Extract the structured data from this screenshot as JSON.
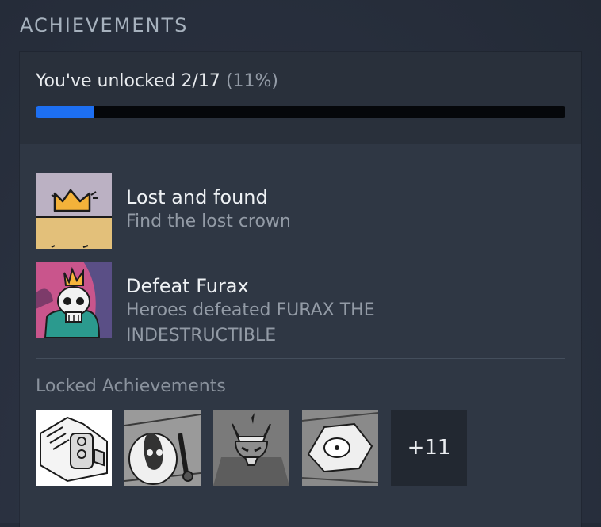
{
  "section": {
    "title": "ACHIEVEMENTS"
  },
  "progress": {
    "text": "You've unlocked 2/17",
    "percent_text": "(11%)",
    "fraction": 0.11
  },
  "unlocked": [
    {
      "title": "Lost and found",
      "description": "Find the lost crown",
      "icon": "crown-achievement-icon"
    },
    {
      "title": "Defeat Furax",
      "description": "Heroes defeated FURAX THE INDESTRUCTIBLE",
      "icon": "skull-achievement-icon"
    }
  ],
  "locked": {
    "label": "Locked Achievements",
    "icons": [
      "gauntlet-achievement-icon",
      "ghost-achievement-icon",
      "demon-achievement-icon",
      "eye-rock-achievement-icon"
    ],
    "more_label": "+11"
  },
  "colors": {
    "progress_fill": "#1d6ff2",
    "progress_track": "#05070a",
    "panel": "#2f3744"
  }
}
